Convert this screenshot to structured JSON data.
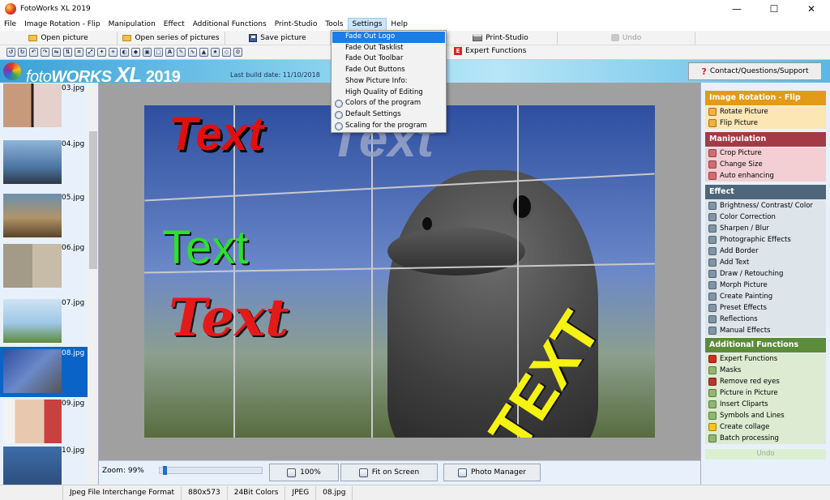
{
  "window": {
    "title": "FotoWorks XL 2019",
    "minimize": "—",
    "maximize": "☐",
    "close": "✕"
  },
  "menubar": {
    "items": [
      "File",
      "Image Rotation - Flip",
      "Manipulation",
      "Effect",
      "Additional Functions",
      "Print-Studio",
      "Tools",
      "Settings",
      "Help"
    ],
    "open_item": "Settings"
  },
  "toolbar1": {
    "open_picture": "Open picture",
    "open_series": "Open series of pictures",
    "save_picture": "Save picture",
    "print_studio": "Print-Studio",
    "undo": "Undo"
  },
  "toolbar2": {
    "expert_functions": "Expert Functions"
  },
  "banner": {
    "logo_foto": "foto",
    "logo_works": "WORKS",
    "logo_xl": "XL",
    "logo_year": "2019",
    "build_date": "Last build date: 11/10/2018",
    "contact": "Contact/Questions/Support"
  },
  "settings_menu": {
    "items": [
      "Fade Out Logo",
      "Fade Out Tasklist",
      "Fade Out Toolbar",
      "Fade Out Buttons",
      "Show Picture Info:",
      "High Quality of Editing",
      "Colors of the program",
      "Default Settings",
      "Scaling for the program"
    ],
    "highlighted": "Fade Out Logo"
  },
  "thumbnails": [
    "03.jpg",
    "04.jpg",
    "05.jpg",
    "06.jpg",
    "07.jpg",
    "08.jpg",
    "09.jpg",
    "10.jpg"
  ],
  "selected_thumbnail": "08.jpg",
  "photo_texts": {
    "red": "Text",
    "grey": "Text",
    "green": "Text",
    "red_script": "Text",
    "yellow": "TEXT"
  },
  "bottom": {
    "zoom": "Zoom: 99%",
    "zoom_value": 0.03,
    "btn_100": "100%",
    "btn_fit": "Fit on Screen",
    "btn_manager": "Photo Manager"
  },
  "right_panel": {
    "sections": [
      {
        "title": "Image Rotation - Flip",
        "color": "#e39a18",
        "items": [
          "Rotate Picture",
          "Flip Picture"
        ],
        "item_bg": "#fbe6b4"
      },
      {
        "title": "Manipulation",
        "color": "#a33a45",
        "items": [
          "Crop Picture",
          "Change Size",
          "Auto enhancing"
        ],
        "item_bg": "#f3cfd3"
      },
      {
        "title": "Effect",
        "color": "#4e6679",
        "items": [
          "Brightness/ Contrast/ Color",
          "Color Correction",
          "Sharpen / Blur",
          "Photographic Effects",
          "Add Border",
          "Add Text",
          "Draw / Retouching",
          "Morph Picture",
          "Create Painting",
          "Preset Effects",
          "Reflections",
          "Manual Effects"
        ],
        "item_bg": "#dde4ea"
      },
      {
        "title": "Additional Functions",
        "color": "#5c8c3a",
        "items": [
          "Expert Functions",
          "Masks",
          "Remove red eyes",
          "Picture in Picture",
          "Insert Cliparts",
          "Symbols and Lines",
          "Create collage",
          "Batch processing"
        ],
        "item_bg": "#dcebd1"
      }
    ],
    "undo": "Undo"
  },
  "statusbar": {
    "format": "Jpeg File Interchange Format",
    "size": "880x573",
    "colors": "24Bit Colors",
    "type": "JPEG",
    "file": "08.jpg"
  }
}
